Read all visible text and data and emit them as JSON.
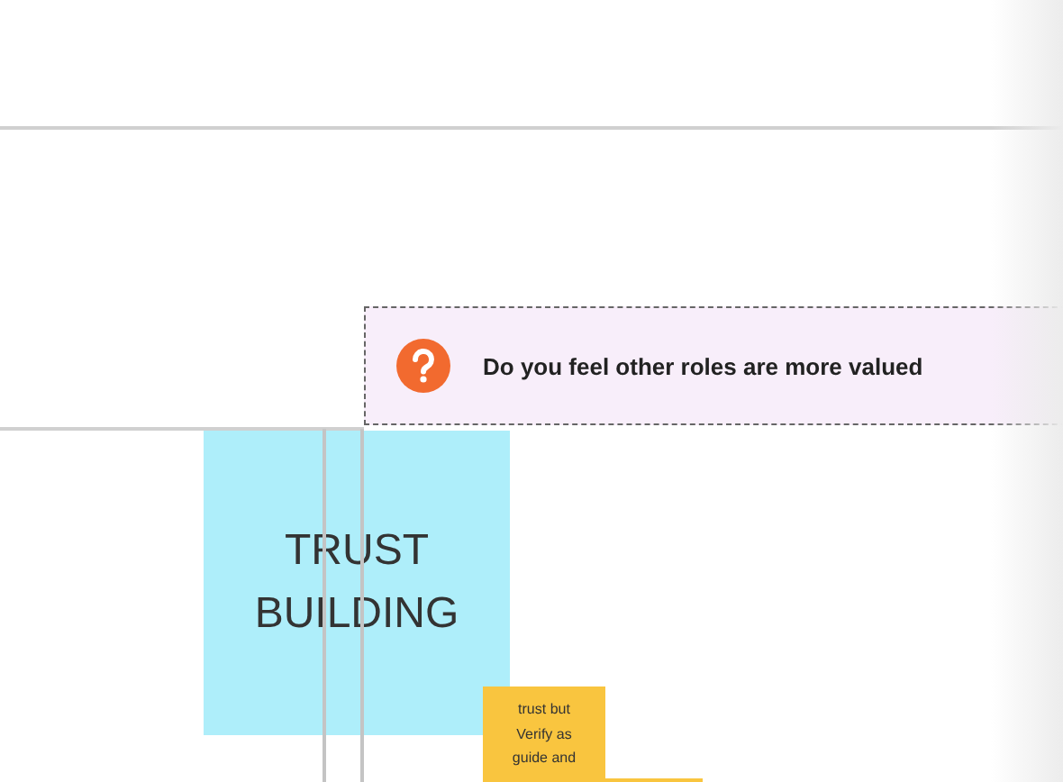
{
  "question_card": {
    "text": "Do you feel other roles are more valued"
  },
  "shapes": [
    {
      "kind": "square",
      "text": "TRUST BUILDING"
    },
    {
      "kind": "sticky",
      "text": "trust but Verify as guide and"
    },
    {
      "kind": "sticky"
    }
  ]
}
